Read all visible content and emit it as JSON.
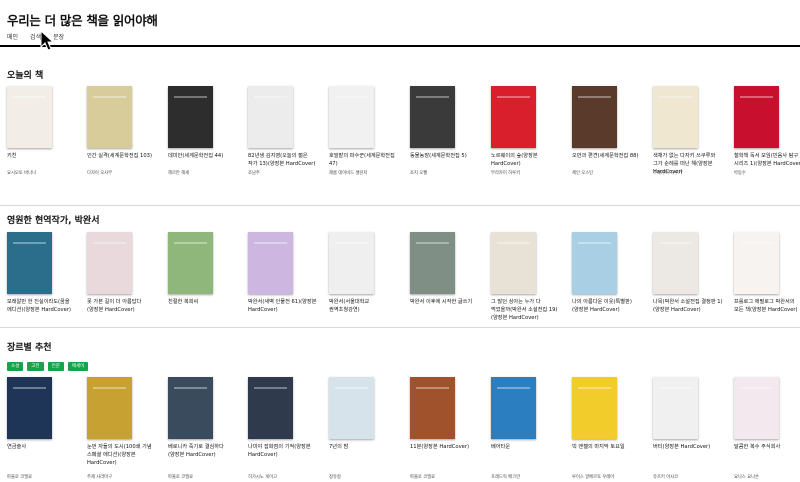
{
  "header": {
    "title": "우리는 더 많은 책을 읽어야해",
    "nav": [
      "메인",
      "검색",
      "문장"
    ]
  },
  "sections": [
    {
      "title": "오늘의 책",
      "books": [
        {
          "title": "키친",
          "author": "요시모토 바나나",
          "cover": "#f2eee7"
        },
        {
          "title": "인간 실격(세계문학전집 103)",
          "author": "다자이 오사무",
          "cover": "#d8cc9a"
        },
        {
          "title": "데미안(세계문학전집 44)",
          "author": "헤르만 헤세",
          "cover": "#2d2d2d"
        },
        {
          "title": "82년생 김지영(오늘의 젊은 작가 13)(양장본 HardCover)",
          "author": "조남주",
          "cover": "#ececec"
        },
        {
          "title": "호밀밭의 파수꾼(세계문학전집 47)",
          "author": "제롬 데이비드 샐린저",
          "cover": "#f1f1f1"
        },
        {
          "title": "동물농장(세계문학전집 5)",
          "author": "조지 오웰",
          "cover": "#3a3a3a"
        },
        {
          "title": "노르웨이의 숲(양장본 HardCover)",
          "author": "무라카미 하루키",
          "cover": "#d91f2b"
        },
        {
          "title": "오만과 편견(세계문학전집 88)",
          "author": "제인 오스틴",
          "cover": "#5a3a2a"
        },
        {
          "title": "색채가 없는 다자키 쓰쿠루와 그가 순례를 떠난 해(양장본 HardCover)",
          "author": "무라카미 하루키",
          "cover": "#efe7cf"
        },
        {
          "title": "철학책 독서 모임(민음사 탐구 시리즈 1)(양장본 HardCover)",
          "author": "박동수",
          "cover": "#c8102e"
        }
      ]
    },
    {
      "title": "영원한 현역작가, 박완서",
      "books": [
        {
          "title": "모래알만 한 진실이라도(꿈을 에디션)(양장본 HardCover)",
          "author": "",
          "cover": "#2a6e8c"
        },
        {
          "title": "못 가본 길이 더 아름답다(양장본 HardCover)",
          "author": "",
          "cover": "#e9d9dc"
        },
        {
          "title": "친절한 복희씨",
          "author": "",
          "cover": "#8fb77b"
        },
        {
          "title": "박완서(새벽 인물전 61)(양장본 HardCover)",
          "author": "",
          "cover": "#cdb7e0"
        },
        {
          "title": "박완서(서울대학교 권역초청강연)",
          "author": "",
          "cover": "#efefef"
        },
        {
          "title": "박완서 이후에 시작한 글쓰기",
          "author": "",
          "cover": "#7f8f86"
        },
        {
          "title": "그 많던 싱아는 누가 다 먹었을까(박완서 소설전집 19)(양장본 HardCover)",
          "author": "",
          "cover": "#e7e2d5"
        },
        {
          "title": "나의 아름다운 이웃(특별판)(양장본 HardCover)",
          "author": "",
          "cover": "#a8cfe3"
        },
        {
          "title": "나목(박완서 소설전집 결정판 1)(양장본 HardCover)",
          "author": "",
          "cover": "#ece9e4"
        },
        {
          "title": "프롤로그 에필로그 박완서의 모든 책(양장본 HardCover)",
          "author": "",
          "cover": "#f6f3f0"
        }
      ]
    },
    {
      "title": "장르별 추천",
      "books": [
        {
          "title": "연금술사",
          "author": "파울로 코엘료",
          "cover": "#1f3557"
        },
        {
          "title": "눈먼 자들의 도시(100쇄 기념 스페셜 에디션)(양장본 HardCover)",
          "author": "주제 사라마구",
          "cover": "#c7a233"
        },
        {
          "title": "베로니카 죽기로 결심하다(양장본 HardCover)",
          "author": "파울로 코엘료",
          "cover": "#3b4b5e"
        },
        {
          "title": "나미야 잡화점의 기적(양장본 HardCover)",
          "author": "히가시노 게이고",
          "cover": "#2f3b4d"
        },
        {
          "title": "7년의 밤",
          "author": "정유정",
          "cover": "#d6e3ea"
        },
        {
          "title": "11분(양장본 HardCover)",
          "author": "파울로 코엘료",
          "cover": "#a0522d"
        },
        {
          "title": "베어타운",
          "author": "프레드릭 배크만",
          "cover": "#2b7fc1"
        },
        {
          "title": "빅 엔젤의 마지막 토요일",
          "author": "루이스 알베르토 우레아",
          "cover": "#f2cc2b"
        },
        {
          "title": "버티(양장본 HardCover)",
          "author": "유즈키 아사코",
          "cover": "#f0f0f0"
        },
        {
          "title": "달콤한 복수 주식회사",
          "author": "요나스 요나손",
          "cover": "#f2e8ee"
        }
      ]
    }
  ],
  "genres": [
    "소설",
    "고전",
    "인문",
    "에세이"
  ],
  "accent_color": "#16a34a"
}
